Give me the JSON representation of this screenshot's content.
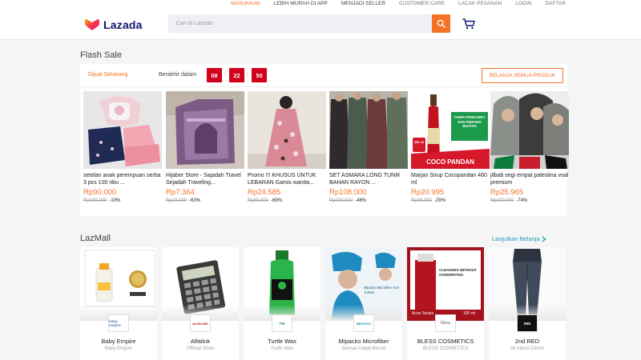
{
  "topbar": {
    "links": [
      "MASUKKAN",
      "LEBIH MURAH DI APP",
      "MENJADI SELLER",
      "CUSTOMER CARE",
      "LACAK PESANAN",
      "LOGIN",
      "DAFTAR"
    ]
  },
  "header": {
    "logo_text": "Lazada",
    "search_placeholder": "Cari di Lazada"
  },
  "flash_sale": {
    "title": "Flash Sale",
    "on_sale_label": "Dijual Sekarang",
    "ends_label": "Berakhir dalam",
    "timer": {
      "hours": "08",
      "minutes": "22",
      "seconds": "50"
    },
    "shop_all_label": "BELANJA SEMUA PRODUK",
    "items": [
      {
        "name": "setelan anak perempuan serba 3 pcs 100 ribu ...",
        "price": "Rp90.000",
        "old_price": "Rp100.000",
        "discount": "-10%"
      },
      {
        "name": "Hijaber Store - Sajadah Travel Sejadah Traveling...",
        "price": "Rp7.364",
        "old_price": "Rp20.000",
        "discount": "-63%"
      },
      {
        "name": "Promo !!! KHUSUS UNTUK LEBARAN Gamis wanita...",
        "price": "Rp24.585",
        "old_price": "Rp80.500",
        "discount": "-69%"
      },
      {
        "name": "SET ASMARA LONG TUNIK BAHAN RAYON ...",
        "price": "Rp108.000",
        "old_price": "Rp199.500",
        "discount": "-46%"
      },
      {
        "name": "Marjan Sirup Cocopandan 460 ml",
        "price": "Rp20.995",
        "old_price": "Rp29.392",
        "discount": "-29%"
      },
      {
        "name": "jilbab segi empat palestina voal premium",
        "price": "Rp25.965",
        "old_price": "Rp100.000",
        "discount": "-74%"
      }
    ]
  },
  "marjan_label": {
    "size": "460 ml",
    "tag": "TANPA PENGAWET DAN PEMANIS BUATAN",
    "flavor": "COCO PANDAN"
  },
  "lazmall": {
    "title": "LazMall",
    "more_label": "Lanjutkan Belanja",
    "stores": [
      {
        "brand": "Baby Empire",
        "sub": "Baby Empire",
        "badge": "baby empire"
      },
      {
        "brand": "Alfalink",
        "sub": "Official Store",
        "badge": "ALFALINK"
      },
      {
        "brand": "Turtle Wax",
        "sub": "Turtle Wax",
        "badge": "TW"
      },
      {
        "brand": "Mipacko Microfiber",
        "sub": "Semua Cepat Bersih",
        "badge": "MIPACKO"
      },
      {
        "brand": "BLESS COSMETICS",
        "sub": "BLESS COSMETICS",
        "badge": "bless"
      },
      {
        "brand": "2nd RED",
        "sub": "All About Denim",
        "badge": "2ND"
      }
    ],
    "image_text": {
      "mipacko": "Mipacko Microfiber Hair Turban",
      "bless_top": "CLEANSES WITHOUT OVERDRYING",
      "bless_bottom": "Acne Series",
      "bless_size": "100 ml"
    }
  },
  "colors": {
    "accent": "#f57224",
    "timer": "#d0011b",
    "link": "#1a9cb7",
    "logo_text": "#0f146d"
  }
}
